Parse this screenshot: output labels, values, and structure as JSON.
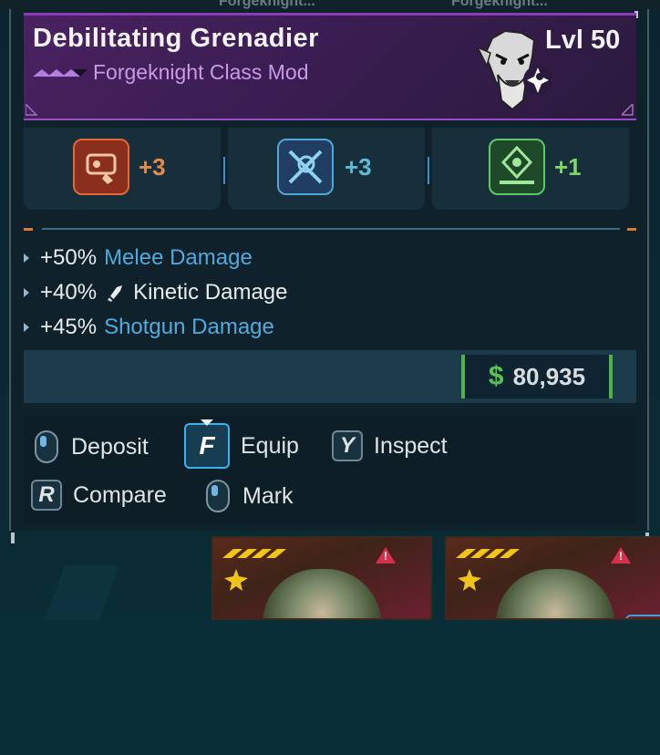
{
  "top_tabs": [
    "Forgeknight...",
    "Forgeknight..."
  ],
  "item": {
    "name": "Debilitating Grenadier",
    "type": "Forgeknight Class Mod",
    "level": "Lvl 50"
  },
  "skills": [
    {
      "icon": "grenade-skill-icon",
      "value": "+3",
      "color": "#e08a4c"
    },
    {
      "icon": "crossed-blades-skill-icon",
      "value": "+3",
      "color": "#5fb9d6"
    },
    {
      "icon": "ground-burst-skill-icon",
      "value": "+1",
      "color": "#7fd46a"
    }
  ],
  "bonuses": [
    {
      "pct": "+50%",
      "label": "Melee Damage",
      "style": "highlight"
    },
    {
      "pct": "+40%",
      "label": "Kinetic Damage",
      "style": "plain",
      "icon": "kinetic-bullet-icon"
    },
    {
      "pct": "+45%",
      "label": "Shotgun Damage",
      "style": "highlight"
    }
  ],
  "price": {
    "symbol": "$",
    "value": "80,935"
  },
  "actions": [
    {
      "key": "mouse",
      "label": "Deposit"
    },
    {
      "key": "F",
      "label": "Equip"
    },
    {
      "key": "Y",
      "label": "Inspect"
    },
    {
      "key": "R",
      "label": "Compare"
    },
    {
      "key": "mouse",
      "label": "Mark"
    }
  ],
  "colors": {
    "header_purple": "#4a2260",
    "subtitle_purple": "#c89ae8",
    "highlight_blue": "#52a9dc",
    "price_green": "#4db34a"
  }
}
